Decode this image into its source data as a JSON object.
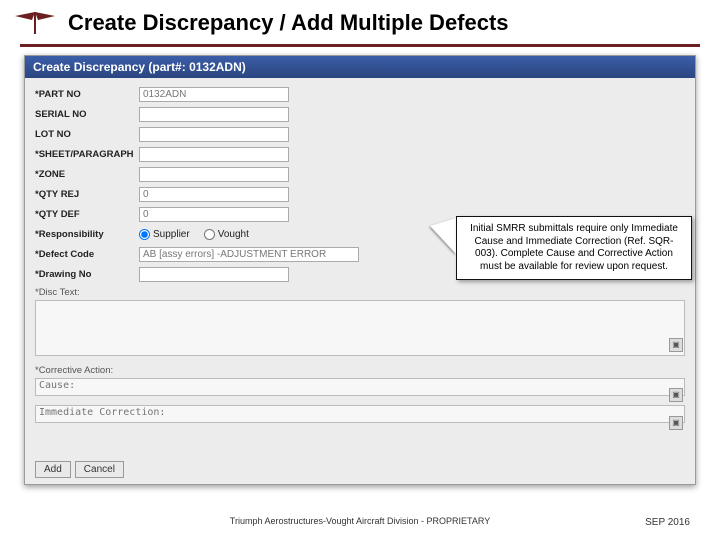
{
  "slide": {
    "title": "Create Discrepancy / Add Multiple Defects"
  },
  "window": {
    "title": "Create Discrepancy (part#: 0132ADN)"
  },
  "form": {
    "labels": {
      "partno": "*PART NO",
      "serialno": "SERIAL NO",
      "lotno": "LOT NO",
      "sheet": "*SHEET/PARAGRAPH",
      "zone": "*ZONE",
      "qtyrej": "*QTY REJ",
      "qtydef": "*QTY DEF",
      "responsibility": "*Responsibility",
      "defectcode": "*Defect Code",
      "drawingno": "*Drawing No",
      "disctext": "*Disc Text:",
      "corrective": "*Corrective Action:",
      "cause": "Cause:",
      "immediate": "Immediate Correction:"
    },
    "values": {
      "partno": "0132ADN",
      "serialno": "",
      "lotno": "",
      "sheet": "",
      "zone": "",
      "qtyrej": "0",
      "qtydef": "0",
      "defectcode": "AB [assy errors] -ADJUSTMENT ERROR",
      "drawingno": ""
    },
    "radios": {
      "supplier": "Supplier",
      "vought": "Vought"
    },
    "buttons": {
      "add": "Add",
      "cancel": "Cancel"
    }
  },
  "callout": {
    "text": "Initial SMRR submittals require only Immediate Cause and Immediate Correction (Ref. SQR-003). Complete Cause and Corrective Action must be available for review upon request."
  },
  "footer": {
    "center": "Triumph Aerostructures-Vought Aircraft Division - PROPRIETARY",
    "right": "SEP 2016"
  }
}
